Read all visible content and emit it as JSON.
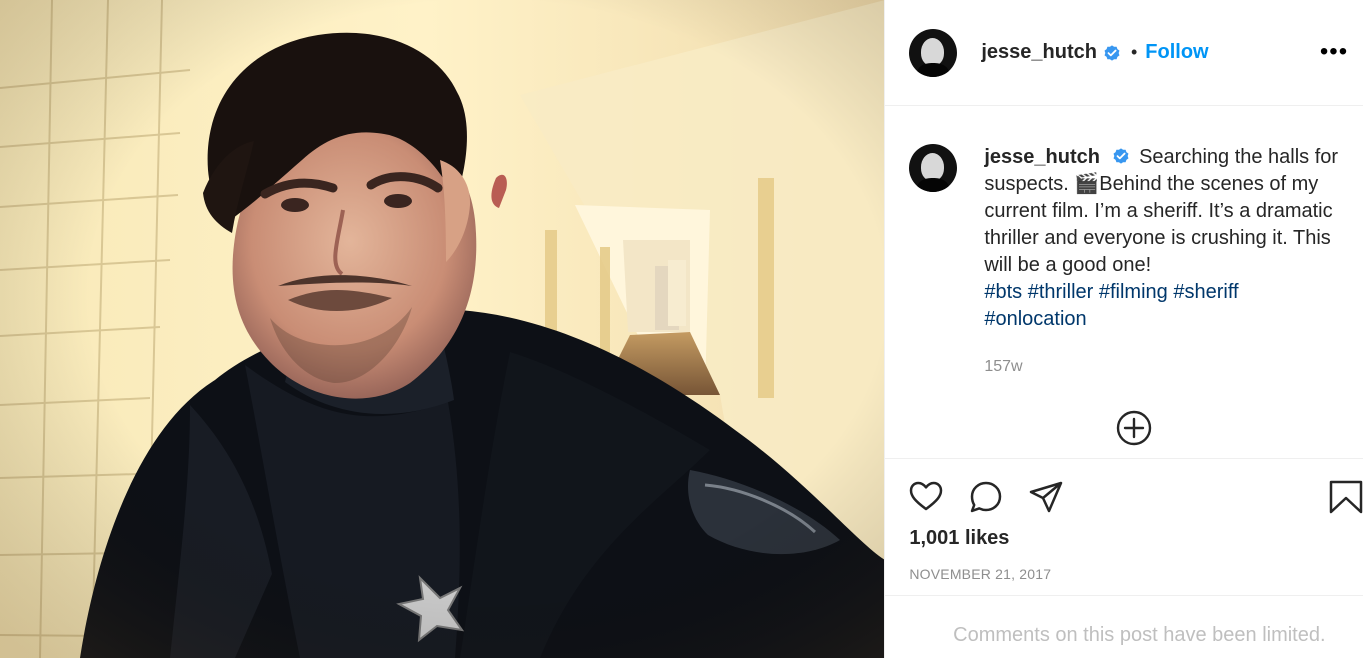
{
  "post": {
    "author": {
      "username": "jesse_hutch",
      "verified": true
    },
    "follow_label": "Follow",
    "separator": "•",
    "more_label": "•••",
    "caption": {
      "username": "jesse_hutch",
      "text": "Searching the halls for suspects. 🎬Behind the scenes of my current film. I’m a sheriff. It’s a dramatic thriller and everyone is crushing it. This will be a good one!",
      "hashtags": [
        "#bts",
        "#thriller",
        "#filming",
        "#sheriff",
        "#onlocation"
      ]
    },
    "time": "157w",
    "likes": "1,001 likes",
    "date": "NOVEMBER 21, 2017",
    "comments_limited_message": "Comments on this post have been limited."
  },
  "icons": {
    "like": "heart-icon",
    "comment": "comment-icon",
    "share": "send-icon",
    "save": "bookmark-icon",
    "add_comment": "plus-circle-icon",
    "verified": "verified-badge-icon"
  },
  "colors": {
    "follow": "#0095f6",
    "hashtag": "#00376b",
    "verified": "#3897f0",
    "muted": "#8e8e8e"
  }
}
